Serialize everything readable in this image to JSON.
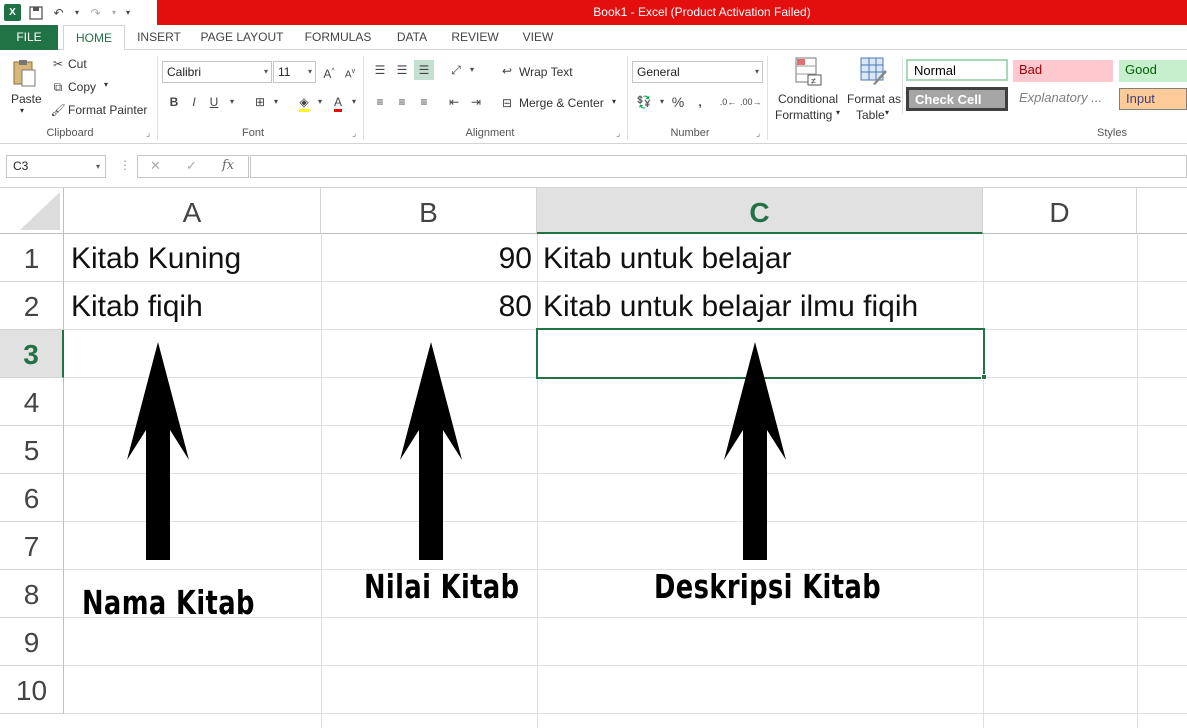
{
  "app": {
    "title": "Book1 -  Excel (Product Activation Failed)",
    "logo": "X"
  },
  "tabs": [
    "FILE",
    "HOME",
    "INSERT",
    "PAGE LAYOUT",
    "FORMULAS",
    "DATA",
    "REVIEW",
    "VIEW"
  ],
  "ribbon": {
    "clipboard": {
      "paste": "Paste",
      "cut": "Cut",
      "copy": "Copy",
      "format_painter": "Format Painter",
      "label": "Clipboard"
    },
    "font": {
      "name": "Calibri",
      "size": "11",
      "bold": "B",
      "italic": "I",
      "underline": "U",
      "label": "Font"
    },
    "alignment": {
      "wrap": "Wrap Text",
      "merge": "Merge & Center",
      "label": "Alignment"
    },
    "number": {
      "format": "General",
      "percent": "%",
      "comma": ",",
      "label": "Number"
    },
    "styles": {
      "conditional_1": "Conditional",
      "conditional_2": "Formatting",
      "format_as_1": "Format as",
      "format_as_2": "Table",
      "normal": "Normal",
      "bad": "Bad",
      "good": "Good",
      "check_cell": "Check Cell",
      "explanatory": "Explanatory ...",
      "input": "Input",
      "label": "Styles"
    }
  },
  "formula_bar": {
    "name_box": "C3",
    "fx": "fx",
    "value": ""
  },
  "sheet": {
    "columns": [
      "A",
      "B",
      "C",
      "D"
    ],
    "rows": [
      "1",
      "2",
      "3",
      "4",
      "5",
      "6",
      "7",
      "8",
      "9",
      "10"
    ],
    "selected_cell": "C3",
    "cells": {
      "A1": "Kitab Kuning",
      "B1": "90",
      "C1": "Kitab untuk belajar",
      "A2": "Kitab fiqih",
      "B2": "80",
      "C2": "Kitab untuk belajar ilmu fiqih"
    }
  },
  "annotations": {
    "a": "Nama Kitab",
    "b": "Nilai Kitab",
    "c": "Deskripsi Kitab"
  },
  "colors": {
    "excel_green": "#217346",
    "title_red": "#e30f0f"
  }
}
